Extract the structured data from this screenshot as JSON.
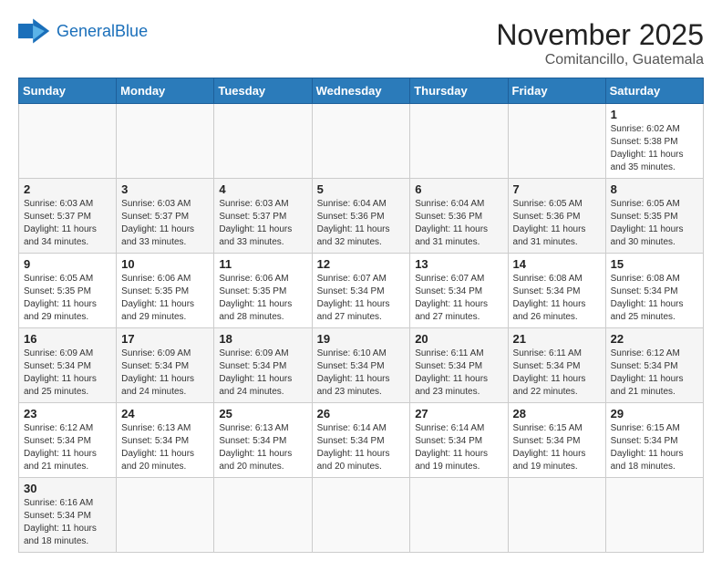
{
  "header": {
    "logo_general": "General",
    "logo_blue": "Blue",
    "month": "November 2025",
    "location": "Comitancillo, Guatemala"
  },
  "weekdays": [
    "Sunday",
    "Monday",
    "Tuesday",
    "Wednesday",
    "Thursday",
    "Friday",
    "Saturday"
  ],
  "weeks": [
    [
      {
        "day": "",
        "info": ""
      },
      {
        "day": "",
        "info": ""
      },
      {
        "day": "",
        "info": ""
      },
      {
        "day": "",
        "info": ""
      },
      {
        "day": "",
        "info": ""
      },
      {
        "day": "",
        "info": ""
      },
      {
        "day": "1",
        "info": "Sunrise: 6:02 AM\nSunset: 5:38 PM\nDaylight: 11 hours and 35 minutes."
      }
    ],
    [
      {
        "day": "2",
        "info": "Sunrise: 6:03 AM\nSunset: 5:37 PM\nDaylight: 11 hours and 34 minutes."
      },
      {
        "day": "3",
        "info": "Sunrise: 6:03 AM\nSunset: 5:37 PM\nDaylight: 11 hours and 33 minutes."
      },
      {
        "day": "4",
        "info": "Sunrise: 6:03 AM\nSunset: 5:37 PM\nDaylight: 11 hours and 33 minutes."
      },
      {
        "day": "5",
        "info": "Sunrise: 6:04 AM\nSunset: 5:36 PM\nDaylight: 11 hours and 32 minutes."
      },
      {
        "day": "6",
        "info": "Sunrise: 6:04 AM\nSunset: 5:36 PM\nDaylight: 11 hours and 31 minutes."
      },
      {
        "day": "7",
        "info": "Sunrise: 6:05 AM\nSunset: 5:36 PM\nDaylight: 11 hours and 31 minutes."
      },
      {
        "day": "8",
        "info": "Sunrise: 6:05 AM\nSunset: 5:35 PM\nDaylight: 11 hours and 30 minutes."
      }
    ],
    [
      {
        "day": "9",
        "info": "Sunrise: 6:05 AM\nSunset: 5:35 PM\nDaylight: 11 hours and 29 minutes."
      },
      {
        "day": "10",
        "info": "Sunrise: 6:06 AM\nSunset: 5:35 PM\nDaylight: 11 hours and 29 minutes."
      },
      {
        "day": "11",
        "info": "Sunrise: 6:06 AM\nSunset: 5:35 PM\nDaylight: 11 hours and 28 minutes."
      },
      {
        "day": "12",
        "info": "Sunrise: 6:07 AM\nSunset: 5:34 PM\nDaylight: 11 hours and 27 minutes."
      },
      {
        "day": "13",
        "info": "Sunrise: 6:07 AM\nSunset: 5:34 PM\nDaylight: 11 hours and 27 minutes."
      },
      {
        "day": "14",
        "info": "Sunrise: 6:08 AM\nSunset: 5:34 PM\nDaylight: 11 hours and 26 minutes."
      },
      {
        "day": "15",
        "info": "Sunrise: 6:08 AM\nSunset: 5:34 PM\nDaylight: 11 hours and 25 minutes."
      }
    ],
    [
      {
        "day": "16",
        "info": "Sunrise: 6:09 AM\nSunset: 5:34 PM\nDaylight: 11 hours and 25 minutes."
      },
      {
        "day": "17",
        "info": "Sunrise: 6:09 AM\nSunset: 5:34 PM\nDaylight: 11 hours and 24 minutes."
      },
      {
        "day": "18",
        "info": "Sunrise: 6:09 AM\nSunset: 5:34 PM\nDaylight: 11 hours and 24 minutes."
      },
      {
        "day": "19",
        "info": "Sunrise: 6:10 AM\nSunset: 5:34 PM\nDaylight: 11 hours and 23 minutes."
      },
      {
        "day": "20",
        "info": "Sunrise: 6:11 AM\nSunset: 5:34 PM\nDaylight: 11 hours and 23 minutes."
      },
      {
        "day": "21",
        "info": "Sunrise: 6:11 AM\nSunset: 5:34 PM\nDaylight: 11 hours and 22 minutes."
      },
      {
        "day": "22",
        "info": "Sunrise: 6:12 AM\nSunset: 5:34 PM\nDaylight: 11 hours and 21 minutes."
      }
    ],
    [
      {
        "day": "23",
        "info": "Sunrise: 6:12 AM\nSunset: 5:34 PM\nDaylight: 11 hours and 21 minutes."
      },
      {
        "day": "24",
        "info": "Sunrise: 6:13 AM\nSunset: 5:34 PM\nDaylight: 11 hours and 20 minutes."
      },
      {
        "day": "25",
        "info": "Sunrise: 6:13 AM\nSunset: 5:34 PM\nDaylight: 11 hours and 20 minutes."
      },
      {
        "day": "26",
        "info": "Sunrise: 6:14 AM\nSunset: 5:34 PM\nDaylight: 11 hours and 20 minutes."
      },
      {
        "day": "27",
        "info": "Sunrise: 6:14 AM\nSunset: 5:34 PM\nDaylight: 11 hours and 19 minutes."
      },
      {
        "day": "28",
        "info": "Sunrise: 6:15 AM\nSunset: 5:34 PM\nDaylight: 11 hours and 19 minutes."
      },
      {
        "day": "29",
        "info": "Sunrise: 6:15 AM\nSunset: 5:34 PM\nDaylight: 11 hours and 18 minutes."
      }
    ],
    [
      {
        "day": "30",
        "info": "Sunrise: 6:16 AM\nSunset: 5:34 PM\nDaylight: 11 hours and 18 minutes."
      },
      {
        "day": "",
        "info": ""
      },
      {
        "day": "",
        "info": ""
      },
      {
        "day": "",
        "info": ""
      },
      {
        "day": "",
        "info": ""
      },
      {
        "day": "",
        "info": ""
      },
      {
        "day": "",
        "info": ""
      }
    ]
  ]
}
